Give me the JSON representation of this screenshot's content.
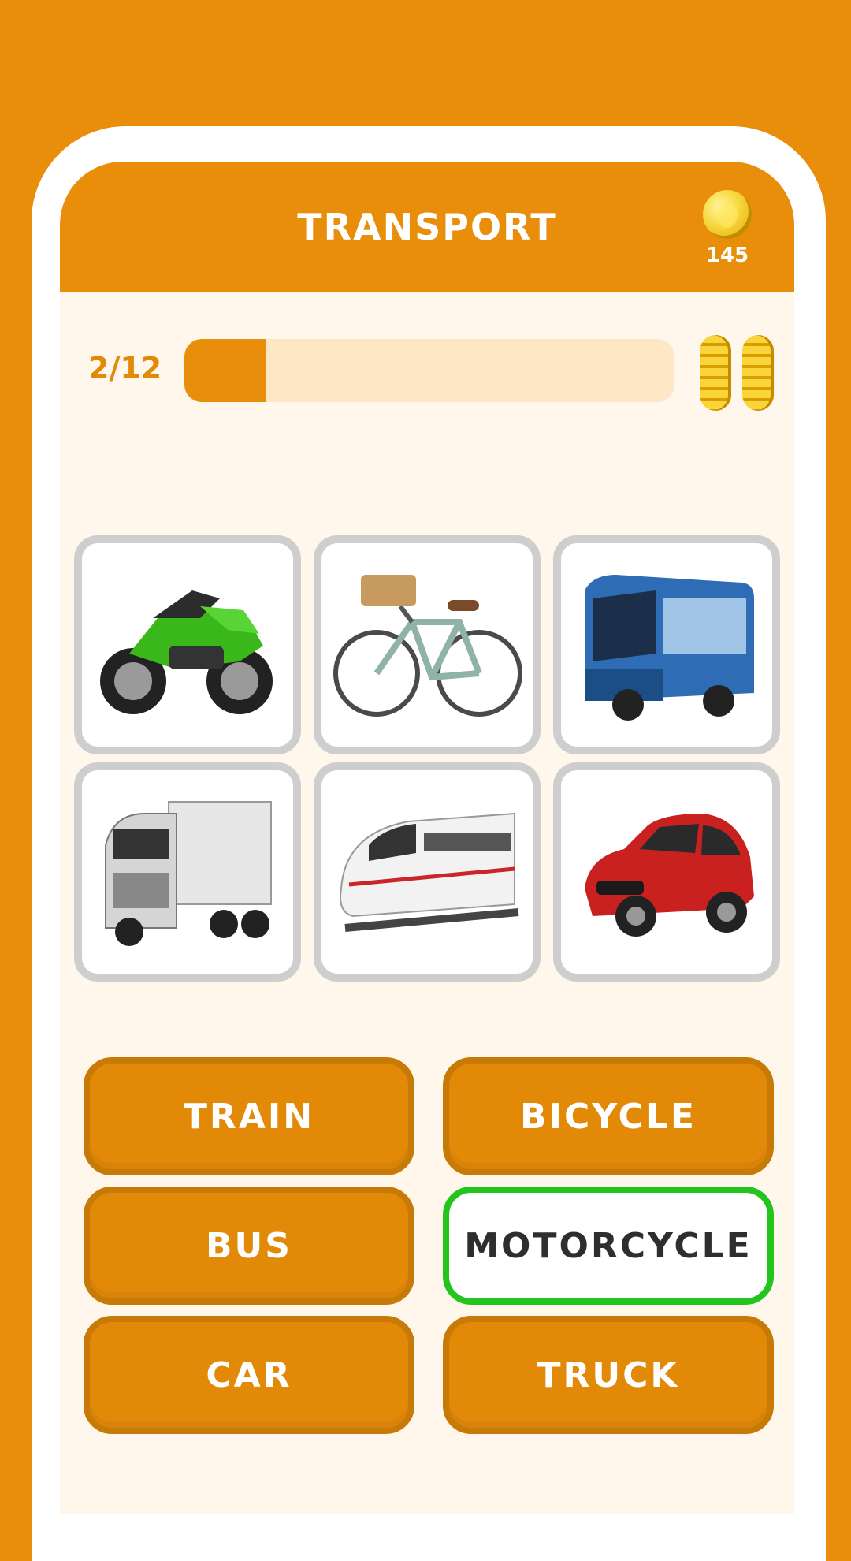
{
  "header": {
    "title": "TRANSPORT",
    "coins": "145"
  },
  "progress": {
    "label": "2/12",
    "fraction": 0.1667
  },
  "pictures": [
    {
      "name": "motorcycle-picture",
      "selected": true
    },
    {
      "name": "bicycle-picture",
      "selected": false
    },
    {
      "name": "bus-picture",
      "selected": false
    },
    {
      "name": "truck-picture",
      "selected": false
    },
    {
      "name": "train-picture",
      "selected": false
    },
    {
      "name": "car-picture",
      "selected": false
    }
  ],
  "answers": [
    {
      "label": "TRAIN",
      "selected": false
    },
    {
      "label": "BICYCLE",
      "selected": false
    },
    {
      "label": "BUS",
      "selected": false
    },
    {
      "label": "MOTORCYCLE",
      "selected": true
    },
    {
      "label": "CAR",
      "selected": false
    },
    {
      "label": "TRUCK",
      "selected": false
    }
  ],
  "colors": {
    "accent": "#E88E0B",
    "selected_border": "#22C41E",
    "background": "#FFF7EC"
  }
}
